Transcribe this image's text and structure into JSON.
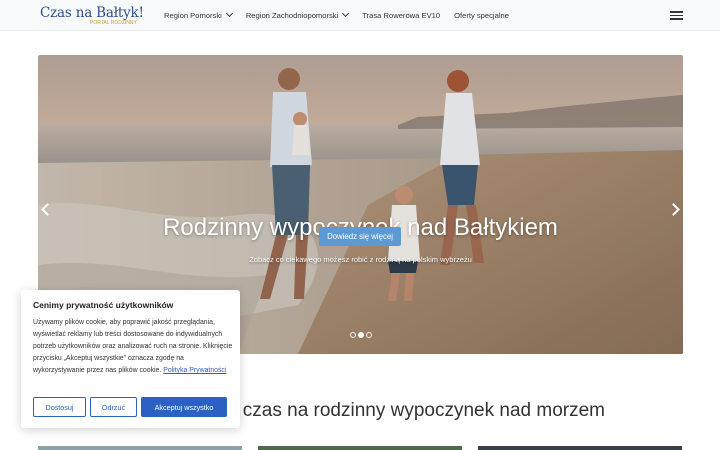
{
  "header": {
    "logo_text": "Czas na Bałtyk!",
    "logo_sub": "PORTAL RODZINNY",
    "nav": [
      {
        "label": "Region Pomorski",
        "has_dropdown": true
      },
      {
        "label": "Region Zachodniopomorski",
        "has_dropdown": true
      },
      {
        "label": "Trasa Rowerowa EV10",
        "has_dropdown": false
      },
      {
        "label": "Oferty specjalne",
        "has_dropdown": false
      }
    ],
    "menu_icon": "hamburger-icon"
  },
  "hero": {
    "title": "Rodzinny wypoczynek nad Bałtykiem",
    "subtitle": "Zobacz co ciekawego możesz robić z rodziną na polskim wybrzeżu",
    "button_label": "Dowiedz się więcej",
    "slide_count": 3,
    "active_slide": 2,
    "prev_icon": "chevron-left-icon",
    "next_icon": "chevron-right-icon"
  },
  "section": {
    "title": "y czas na rodzinny wypoczynek nad morzem"
  },
  "cookie": {
    "title": "Cenimy prywatność użytkowników",
    "text": "Używamy plików cookie, aby poprawić jakość przeglądania, wyświetlać reklamy lub treści dostosowane do indywidualnych potrzeb użytkowników oraz analizować ruch na stronie. Kliknięcie przycisku „Akceptuj wszystkie” oznacza zgodę na wykorzystywanie przez nas plików cookie.",
    "link_label": "Polityka Prywatności",
    "buttons": {
      "customize": "Dostosuj",
      "reject": "Odrzuć",
      "accept": "Akceptuj wszystko"
    }
  },
  "colors": {
    "accent": "#2b61c3",
    "hero_button": "#5b9ad4",
    "logo": "#2a4f8f"
  }
}
